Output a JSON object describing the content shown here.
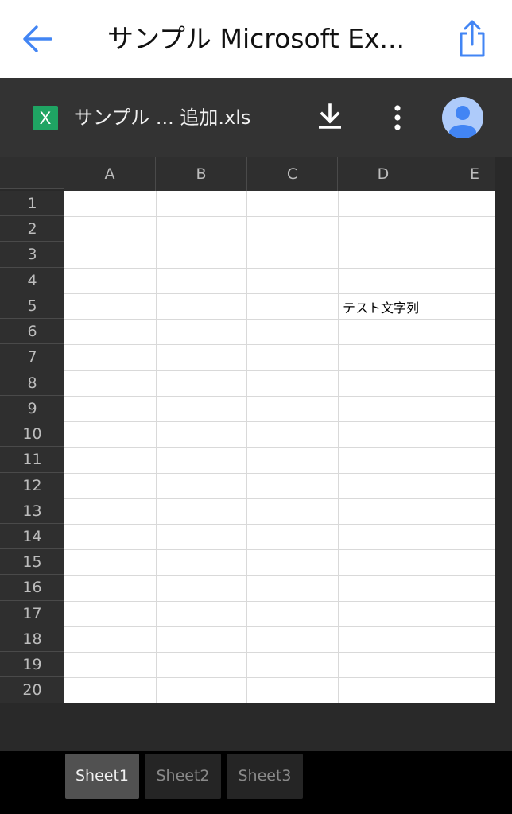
{
  "topbar": {
    "title": "サンプル Microsoft Ex...",
    "back_icon": "back-arrow-icon",
    "share_icon": "share-icon"
  },
  "filebar": {
    "file_icon_letter": "X",
    "file_name": "サンプル ... 追加.xls",
    "download_icon": "download-icon",
    "more_icon": "more-vert-icon",
    "avatar_icon": "account-icon"
  },
  "sheet": {
    "columns": [
      "A",
      "B",
      "C",
      "D",
      "E"
    ],
    "rows": [
      "1",
      "2",
      "3",
      "4",
      "5",
      "6",
      "7",
      "8",
      "9",
      "10",
      "11",
      "12",
      "13",
      "14",
      "15",
      "16",
      "17",
      "18",
      "19",
      "20"
    ],
    "cell_D5": "テスト文字列"
  },
  "tabs": [
    {
      "label": "Sheet1",
      "active": true
    },
    {
      "label": "Sheet2",
      "active": false
    },
    {
      "label": "Sheet3",
      "active": false
    }
  ],
  "colors": {
    "accent_blue": "#4285f4",
    "excel_green": "#1fa463",
    "toolbar_dark": "#333333"
  }
}
